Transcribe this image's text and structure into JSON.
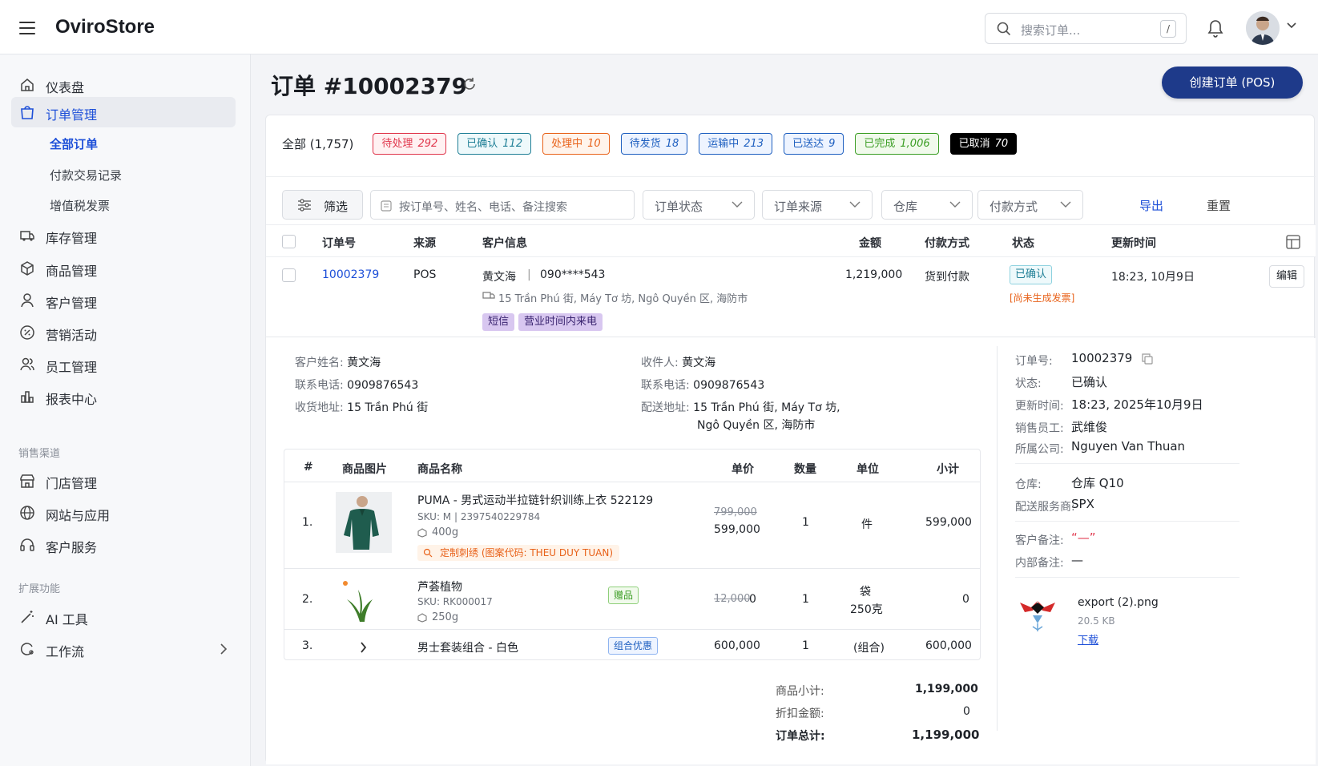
{
  "app": {
    "brand": "OviroStore"
  },
  "header": {
    "search_placeholder": "搜索订单...",
    "search_shortcut": "/"
  },
  "sidebar": {
    "items": [
      {
        "label": "仪表盘",
        "icon": "home-icon"
      },
      {
        "label": "订单管理",
        "icon": "shopping-bag-icon"
      },
      {
        "label": "库存管理",
        "icon": "truck-icon"
      },
      {
        "label": "商品管理",
        "icon": "box-icon"
      },
      {
        "label": "客户管理",
        "icon": "user-icon"
      },
      {
        "label": "营销活动",
        "icon": "percent-badge-icon"
      },
      {
        "label": "员工管理",
        "icon": "users-icon"
      },
      {
        "label": "报表中心",
        "icon": "bar-chart-icon"
      }
    ],
    "sub_items": [
      "全部订单",
      "付款交易记录",
      "增值税发票"
    ],
    "group_sales": "销售渠道",
    "sales_items": [
      {
        "label": "门店管理",
        "icon": "store-icon"
      },
      {
        "label": "网站与应用",
        "icon": "globe-icon"
      },
      {
        "label": "客户服务",
        "icon": "headset-icon"
      }
    ],
    "group_ext": "扩展功能",
    "ext_items": [
      {
        "label": "AI 工具",
        "icon": "magic-wand-icon"
      },
      {
        "label": "工作流",
        "icon": "workflow-icon"
      }
    ]
  },
  "page": {
    "title": "订单 #10002379",
    "create_button": "创建订单 (POS)"
  },
  "status_tabs": {
    "all_label": "全部 (1,757)",
    "chips": [
      {
        "label": "待处理",
        "count": "292",
        "color": "#e0364c",
        "bg": "#fff1f2"
      },
      {
        "label": "已确认",
        "count": "112",
        "color": "#1f7f96",
        "bg": "#eef9fb"
      },
      {
        "label": "处理中",
        "count": "10",
        "color": "#e8621a",
        "bg": "#fff4ec"
      },
      {
        "label": "待发货",
        "count": "18",
        "color": "#1e5fc0",
        "bg": "#eef4ff"
      },
      {
        "label": "运输中",
        "count": "213",
        "color": "#1e5fc0",
        "bg": "#eef4ff"
      },
      {
        "label": "已送达",
        "count": "9",
        "color": "#1e5fc0",
        "bg": "#eef4ff"
      },
      {
        "label": "已完成",
        "count": "1,006",
        "color": "#3a9d23",
        "bg": "#f1faec"
      },
      {
        "label": "已取消",
        "count": "70",
        "color": "#ffffff",
        "bg": "#000000"
      }
    ]
  },
  "filters": {
    "filter_button": "筛选",
    "search_placeholder": "按订单号、姓名、电话、备注搜索",
    "order_status": "订单状态",
    "order_source": "订单来源",
    "warehouse": "仓库",
    "payment_method": "付款方式",
    "export": "导出",
    "reset": "重置"
  },
  "table": {
    "headers": {
      "order_no": "订单号",
      "source": "来源",
      "customer": "客户信息",
      "amount": "金额",
      "payment": "付款方式",
      "status": "状态",
      "updated": "更新时间"
    },
    "row": {
      "order_no": "10002379",
      "source": "POS",
      "customer_name": "黄文海",
      "customer_phone": "090****543",
      "address": "15 Trần Phú 街, Máy Tơ 坊, Ngô Quyền 区, 海防市",
      "tags": [
        "短信",
        "营业时间内来电"
      ],
      "amount": "1,219,000",
      "payment": "货到付款",
      "status": "已确认",
      "status_note": "[尚未生成发票]",
      "updated": "18:23, 10月9日",
      "edit": "编辑"
    }
  },
  "detail": {
    "customer_name_label": "客户姓名:",
    "customer_name": "黄文海",
    "phone_label": "联系电话:",
    "phone": "0909876543",
    "address_label": "收货地址:",
    "address": "15 Trần Phú 街",
    "recipient_label": "收件人:",
    "recipient": "黄文海",
    "recipient_phone_label": "联系电话:",
    "recipient_phone": "0909876543",
    "delivery_label": "配送地址:",
    "delivery_line1": "15 Trần Phú 街, Máy Tơ 坊,",
    "delivery_line2": "Ngô Quyền 区, 海防市"
  },
  "items": {
    "headers": {
      "idx": "#",
      "image": "商品图片",
      "name": "商品名称",
      "price": "单价",
      "qty": "数量",
      "unit": "单位",
      "subtotal": "小计"
    },
    "rows": [
      {
        "idx": "1.",
        "name": "PUMA - 男式运动半拉链针织训练上衣 522129",
        "sku": "SKU: M | 2397540229784",
        "weight": "400g",
        "custom": "定制刺绣 (图案代码: THEU DUY TUAN)",
        "old_price": "799,000",
        "price": "599,000",
        "qty": "1",
        "unit": "件",
        "subtotal": "599,000"
      },
      {
        "idx": "2.",
        "name": "芦荟植物",
        "sku": "SKU: RK000017",
        "weight": "250g",
        "badge": "赠品",
        "old_price": "12,000",
        "price": "0",
        "qty": "1",
        "unit": "袋",
        "unit2": "250克",
        "subtotal": "0"
      },
      {
        "idx": "3.",
        "name": "男士套装组合 - 白色",
        "badge": "组合优惠",
        "price": "600,000",
        "qty": "1",
        "unit": "(组合)",
        "subtotal": "600,000"
      }
    ],
    "summary": {
      "subtotal_label": "商品小计:",
      "subtotal": "1,199,000",
      "discount_label": "折扣金额:",
      "discount": "0",
      "total_label": "订单总计:",
      "total": "1,199,000"
    }
  },
  "right_panel": {
    "order_no_label": "订单号:",
    "order_no": "10002379",
    "status_label": "状态:",
    "status": "已确认",
    "updated_label": "更新时间:",
    "updated": "18:23, 2025年10月9日",
    "staff_label": "销售员工:",
    "staff": "武维俊",
    "company_label": "所属公司:",
    "company": "Nguyen Van Thuan",
    "warehouse_label": "仓库:",
    "warehouse": "仓库 Q10",
    "shipper_label": "配送服务商:",
    "shipper": "SPX",
    "customer_note_label": "客户备注:",
    "customer_note": "“—”",
    "internal_note_label": "内部备注:",
    "internal_note": "—",
    "file_name": "export (2).png",
    "file_size": "20.5 KB",
    "download": "下载"
  }
}
